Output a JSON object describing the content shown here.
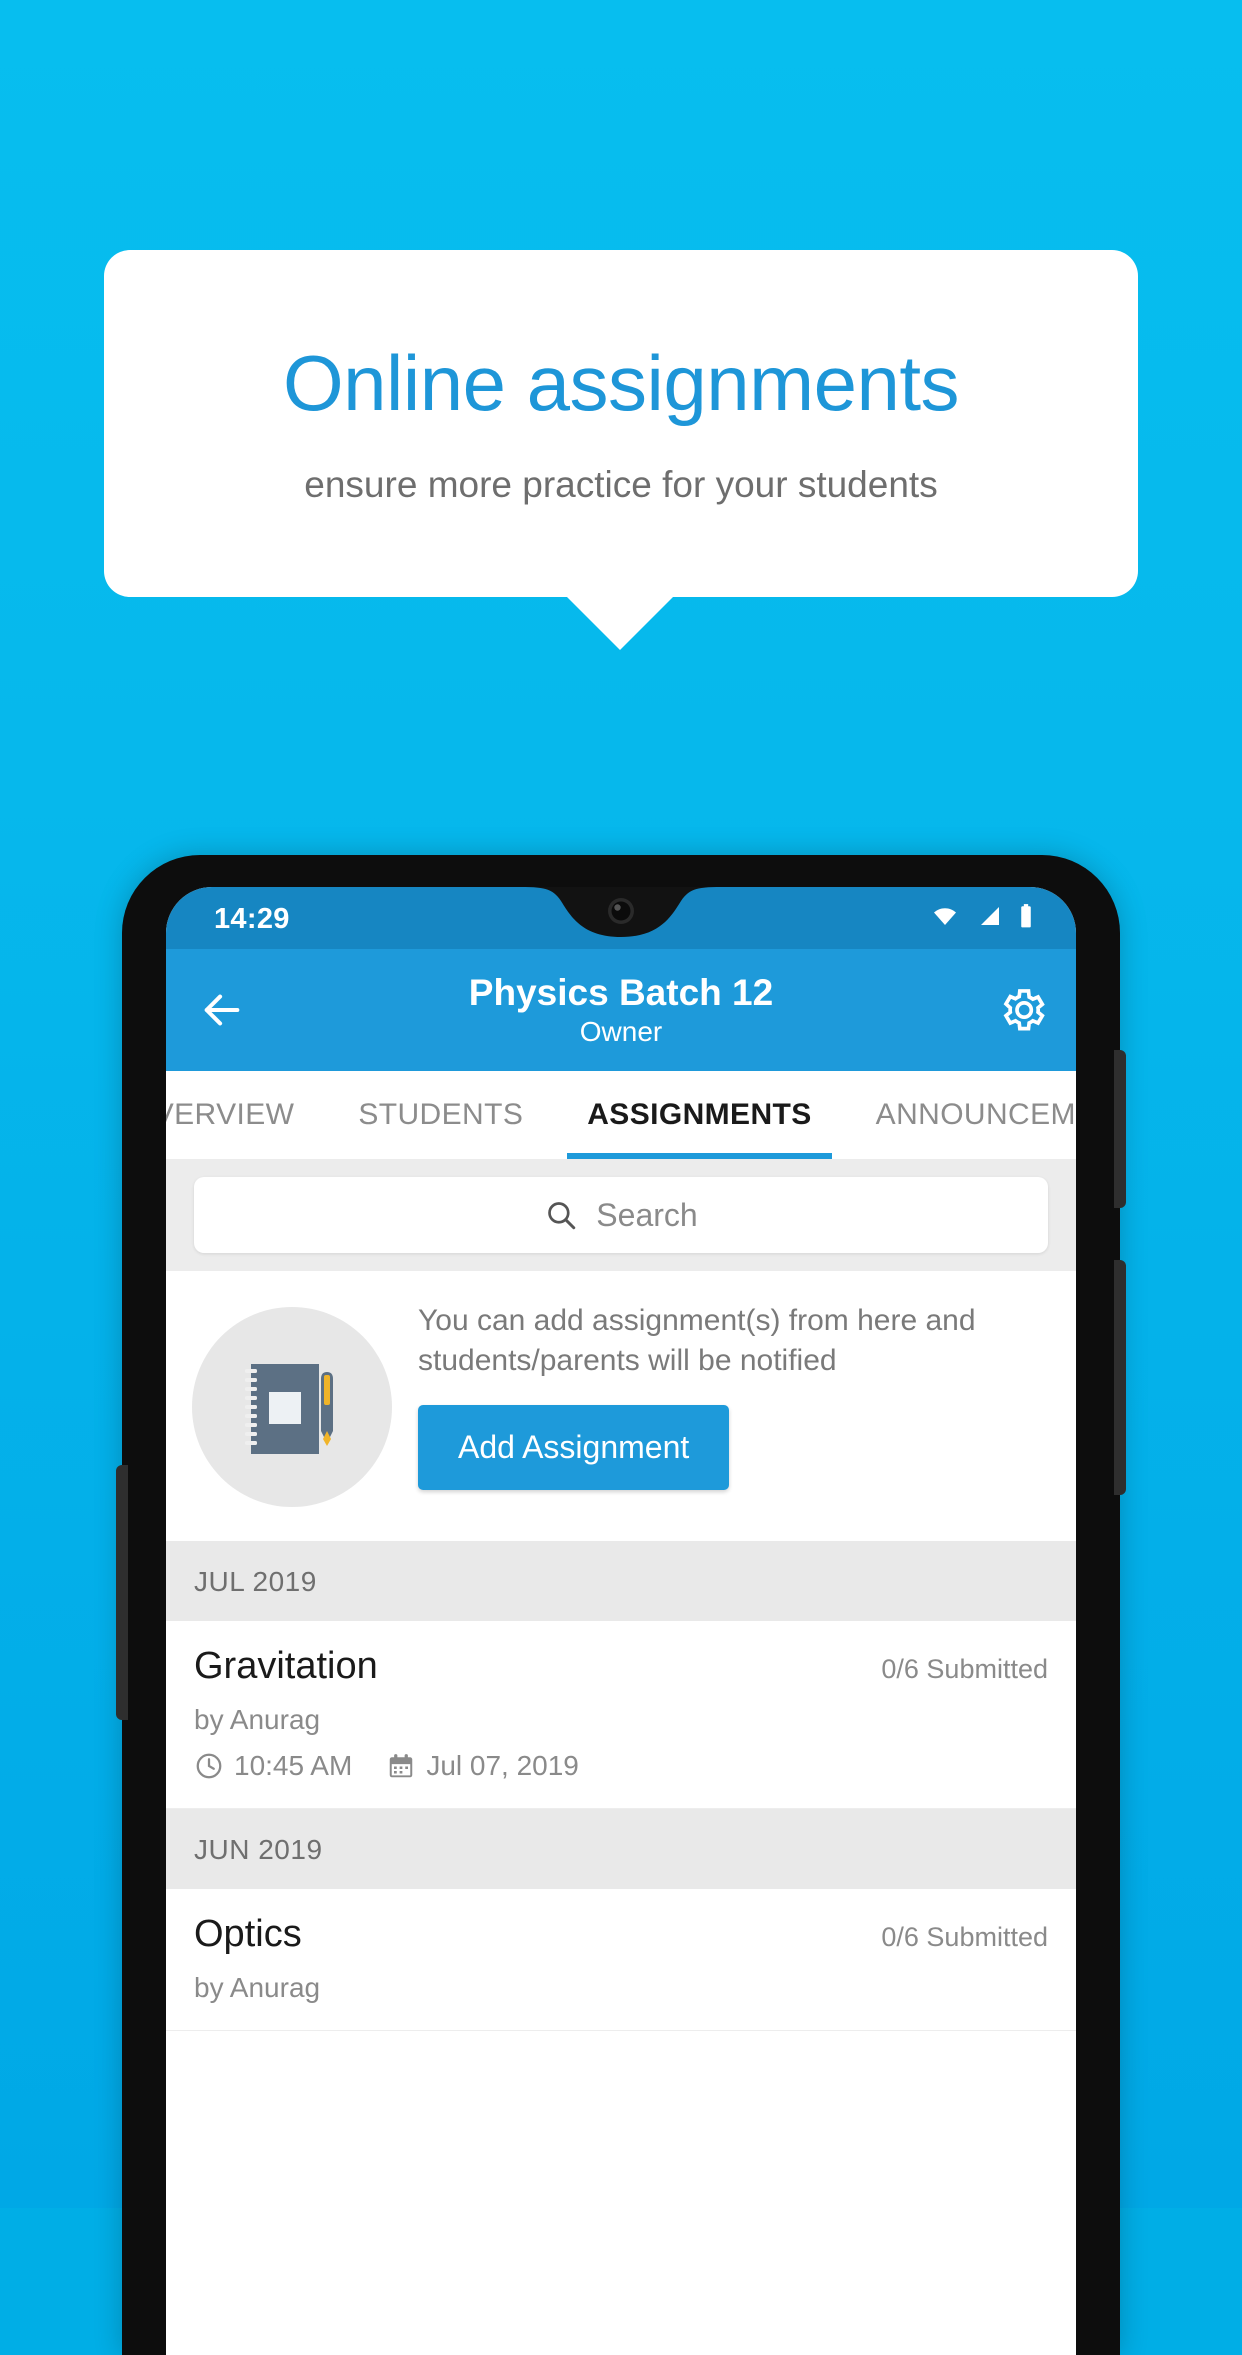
{
  "background": {
    "top_color": "#07BEEF",
    "bottom_color": "#00A8E6"
  },
  "hero": {
    "title": "Online assignments",
    "subtitle": "ensure more practice for your students",
    "title_color": "#1E96D8",
    "subtitle_color": "#6E6E6E"
  },
  "phone": {
    "statusbar": {
      "time": "14:29",
      "icons": [
        "wifi-icon",
        "cellular-signal-icon",
        "battery-icon"
      ],
      "background_color": "#1686C2"
    },
    "appbar": {
      "back_icon": "arrow-left-icon",
      "title": "Physics Batch 12",
      "subtitle": "Owner",
      "settings_icon": "gear-icon",
      "background_color": "#1E9ADA"
    },
    "tabs": [
      {
        "label": "OVERVIEW",
        "active": false
      },
      {
        "label": "STUDENTS",
        "active": false
      },
      {
        "label": "ASSIGNMENTS",
        "active": true
      },
      {
        "label": "ANNOUNCEMENTS",
        "active": false
      }
    ],
    "search": {
      "icon": "search-icon",
      "placeholder": "Search",
      "value": ""
    },
    "empty_state": {
      "illustration": "notebook-and-pen-icon",
      "message": "You can add assignment(s) from here and students/parents will be notified",
      "button_label": "Add Assignment",
      "button_color": "#1E9ADA"
    },
    "sections": [
      {
        "month": "JUL 2019",
        "assignments": [
          {
            "title": "Gravitation",
            "submitted": "0/6 Submitted",
            "author": "by Anurag",
            "time_icon": "clock-icon",
            "time": "10:45 AM",
            "date_icon": "calendar-icon",
            "date": "Jul 07, 2019"
          }
        ]
      },
      {
        "month": "JUN 2019",
        "assignments": [
          {
            "title": "Optics",
            "submitted": "0/6 Submitted",
            "author": "by Anurag",
            "time_icon": "clock-icon",
            "time": "",
            "date_icon": "calendar-icon",
            "date": ""
          }
        ]
      }
    ]
  }
}
